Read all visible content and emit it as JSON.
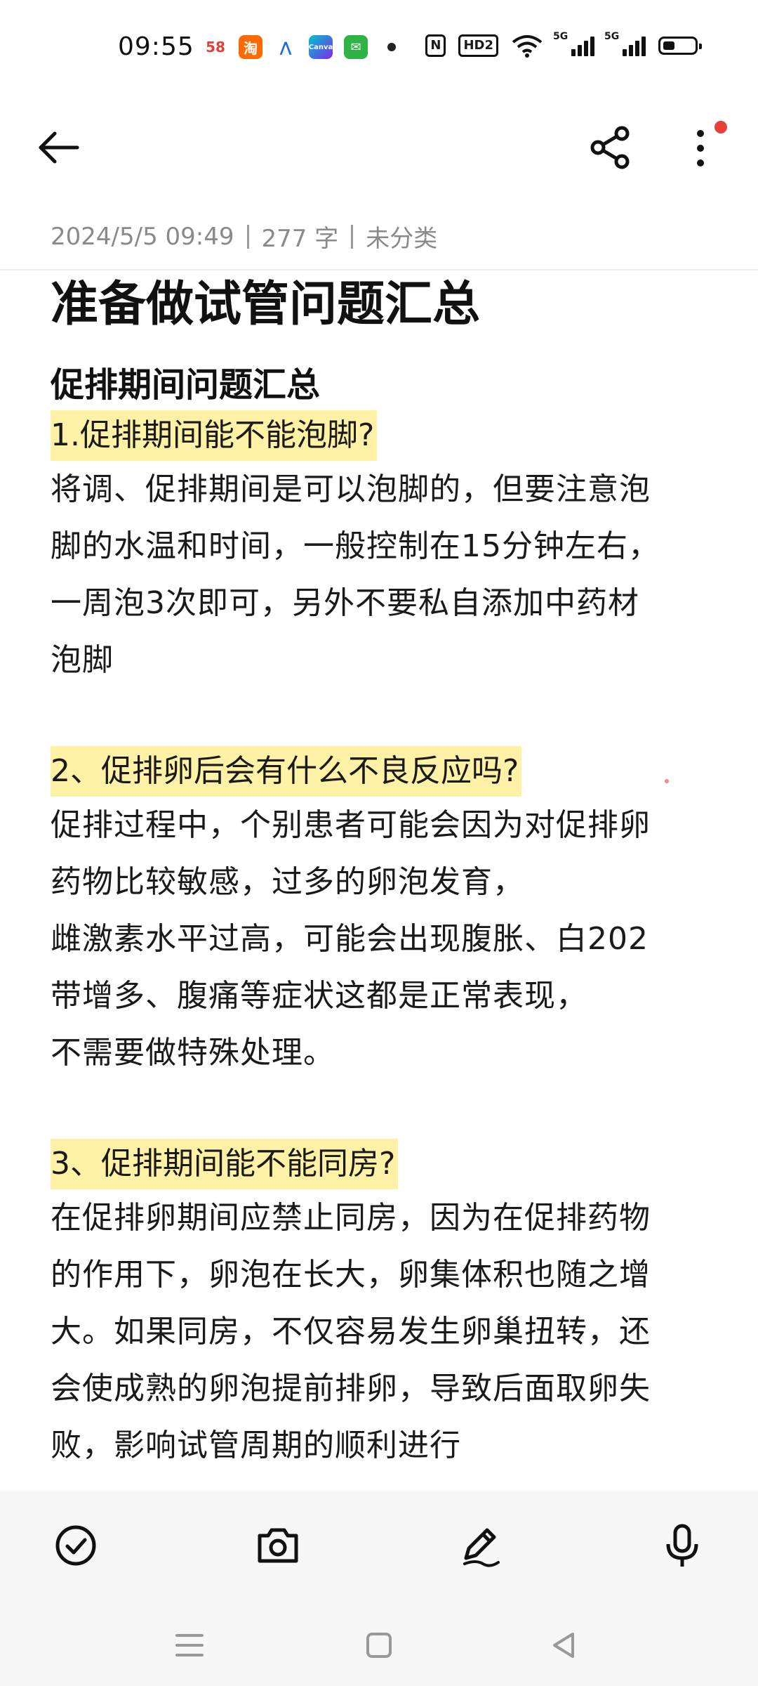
{
  "status": {
    "time": "09:55",
    "apps": [
      {
        "label": "58",
        "color": "#ffffff",
        "text": "#e5413a"
      },
      {
        "label": "淘",
        "color": "#ff6a00",
        "text": "#ffffff"
      },
      {
        "label": "⋀",
        "color": "#ffffff",
        "text": "#1e6bd6"
      },
      {
        "label": "Canva",
        "color": "#7d2ae8",
        "text": "#ffffff"
      },
      {
        "label": "✉",
        "color": "#2fb344",
        "text": "#ffffff"
      }
    ],
    "nfc": "N",
    "hd": "HD2",
    "sig1": "5G",
    "sig2": "5G"
  },
  "header": {
    "meta_date": "2024/5/5 09:49",
    "meta_count": "277 字",
    "meta_category": "未分类"
  },
  "note": {
    "title": "准备做试管问题汇总",
    "section": "促排期间问题汇总",
    "q1": "1.促排期间能不能泡脚?",
    "a1": [
      "将调、促排期间是可以泡脚的，但要注意泡",
      "脚的水温和时间，一般控制在15分钟左右，",
      "一周泡3次即可，另外不要私自添加中药材",
      "泡脚"
    ],
    "q2": "2、促排卵后会有什么不良反应吗?",
    "a2": [
      "促排过程中，个别患者可能会因为对促排卵",
      "药物比较敏感，过多的卵泡发育，",
      "雌激素水平过高，可能会出现腹胀、白202",
      "带增多、腹痛等症状这都是正常表现，",
      "不需要做特殊处理。"
    ],
    "q3": "3、促排期间能不能同房?",
    "a3": [
      "在促排卵期间应禁止同房，因为在促排药物",
      "的作用下，卵泡在长大，卵集体积也随之增",
      "大。如果同房，不仅容易发生卵巢扭转，还",
      "会使成熟的卵泡提前排卵，导致后面取卵失",
      "败，影响试管周期的顺利进行"
    ]
  },
  "icons": {
    "back": "arrow-left-icon",
    "share": "share-icon",
    "more": "more-vertical-icon",
    "check": "checkbox-icon",
    "camera": "camera-icon",
    "pen": "pen-icon",
    "mic": "microphone-icon"
  },
  "colors": {
    "highlight": "#fff1a6",
    "accent_dot": "#e5413a"
  }
}
